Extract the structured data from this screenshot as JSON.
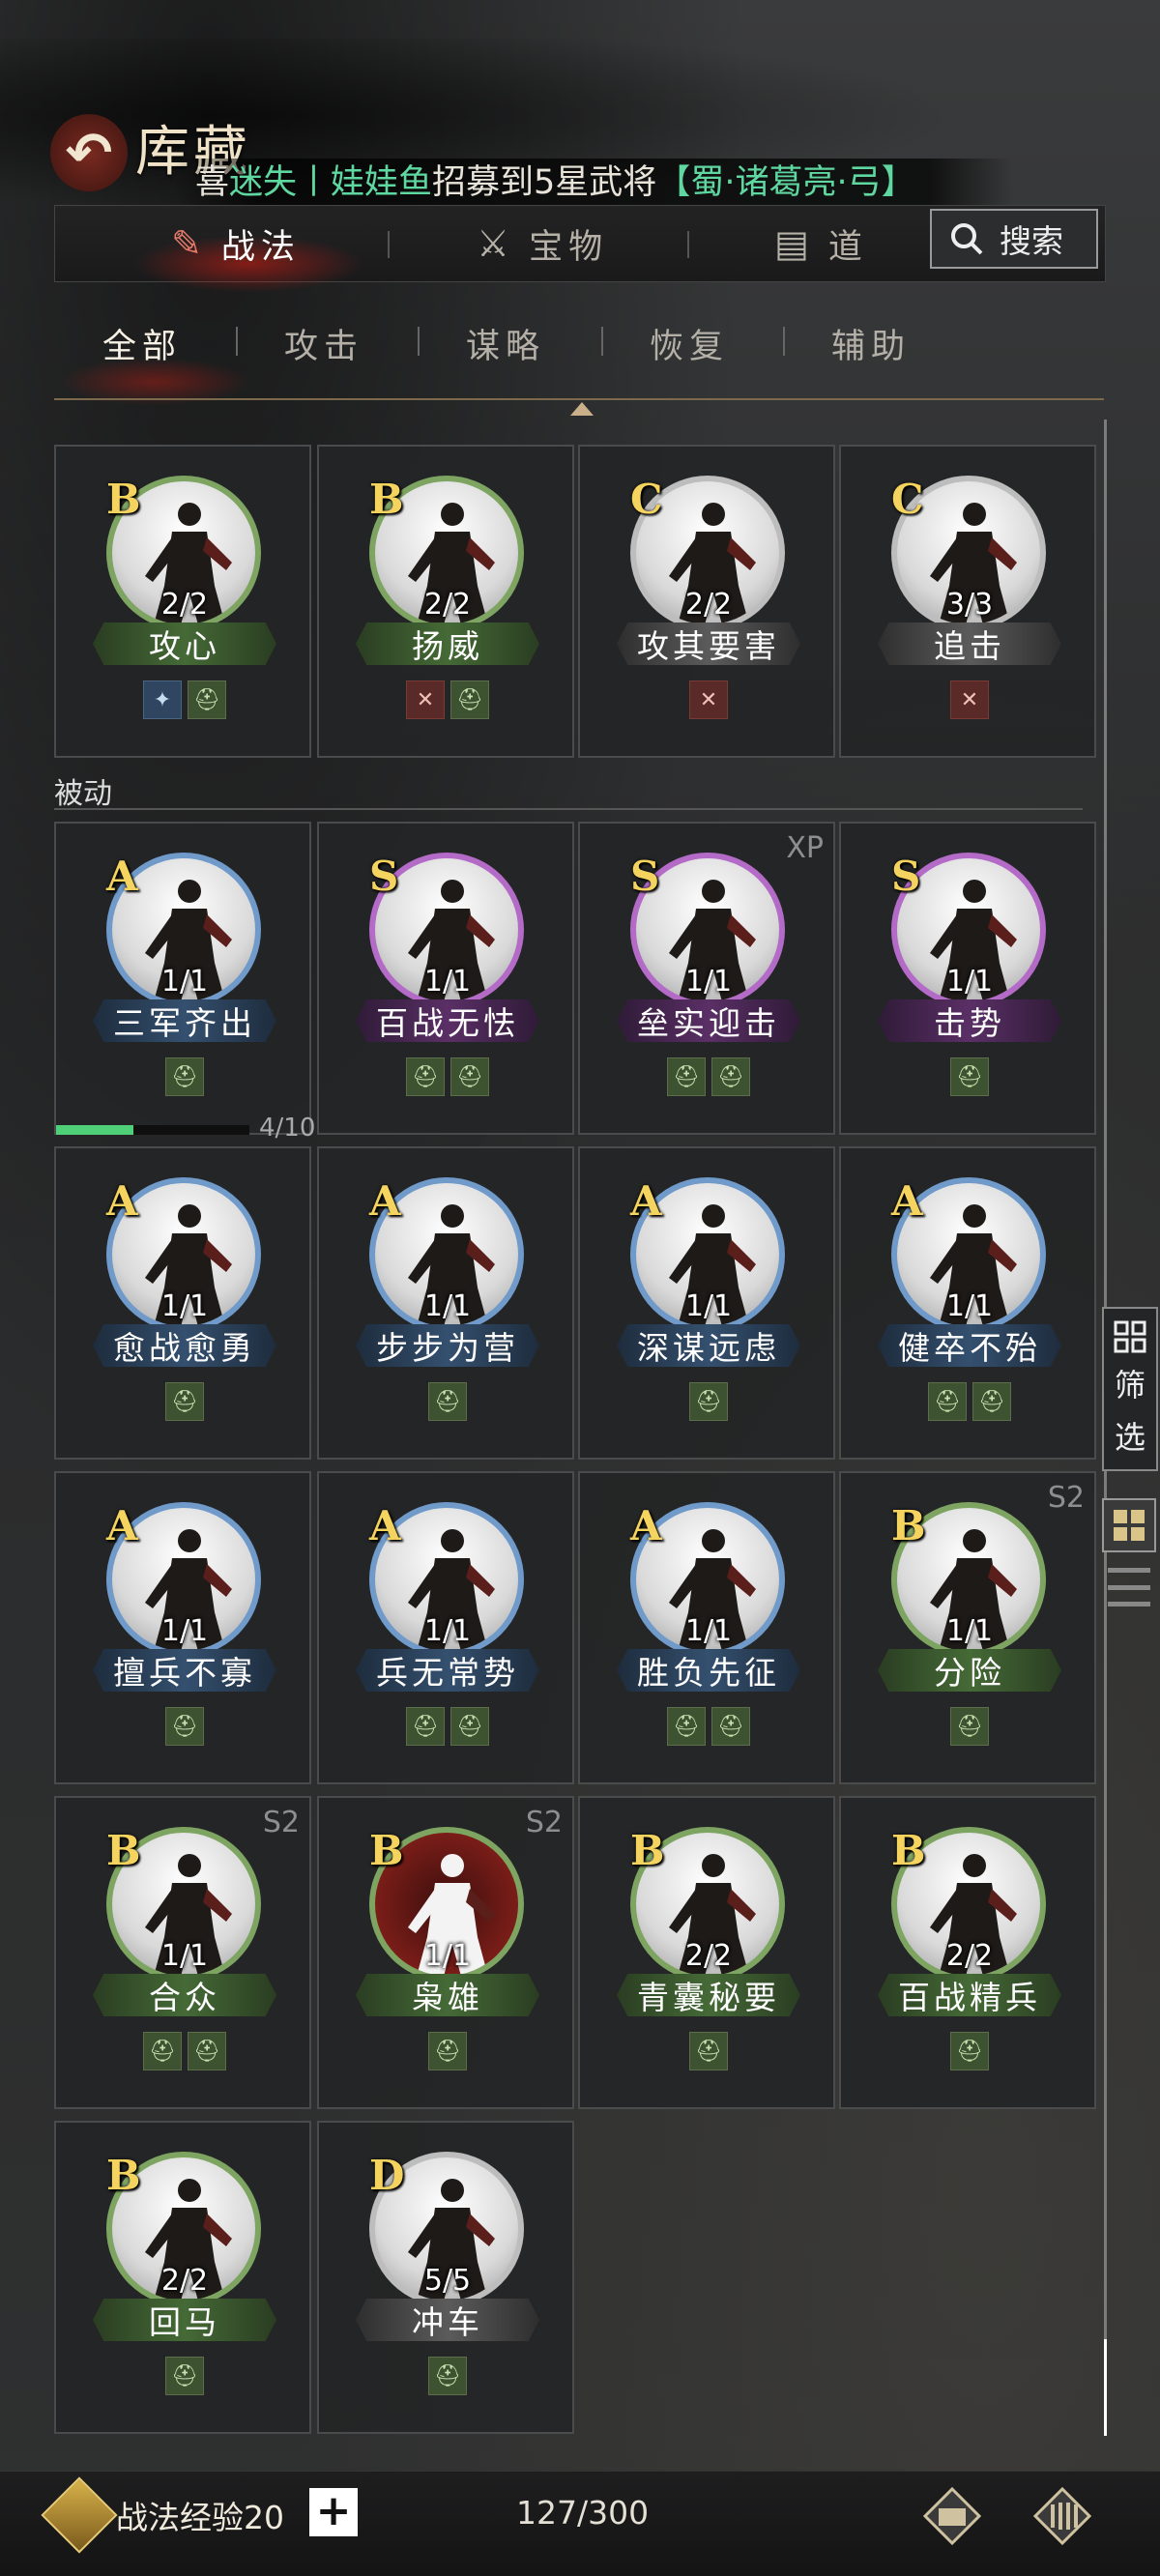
{
  "header": {
    "back_icon": "back-arrow-icon",
    "title": "库藏",
    "marquee": {
      "prefix": "喜",
      "name": "迷失丨娃娃鱼",
      "middle": "招募到5星武将",
      "hero": "【蜀·诸葛亮·弓】"
    }
  },
  "main_tabs": [
    {
      "label": "战法",
      "icon": "scroll-icon",
      "active": true
    },
    {
      "label": "宝物",
      "icon": "treasure-icon",
      "active": false
    },
    {
      "label": "道",
      "icon": "item-icon",
      "active": false
    }
  ],
  "search": {
    "label": "搜索",
    "icon": "search-icon"
  },
  "sub_tabs": [
    "全部",
    "攻击",
    "谋略",
    "恢复",
    "辅助"
  ],
  "active_sub_tab": "全部",
  "section_passive": "被动",
  "rows": [
    [
      {
        "grade": "B",
        "count": "2/2",
        "name": "攻心",
        "rarity": "B",
        "tags": [
          "b",
          "g"
        ]
      },
      {
        "grade": "B",
        "count": "2/2",
        "name": "扬威",
        "rarity": "B",
        "tags": [
          "r",
          "g"
        ]
      },
      {
        "grade": "C",
        "count": "2/2",
        "name": "攻其要害",
        "rarity": "C",
        "tags": [
          "r"
        ]
      },
      {
        "grade": "C",
        "count": "3/3",
        "name": "追击",
        "rarity": "C",
        "tags": [
          "r"
        ]
      }
    ],
    [
      {
        "grade": "A",
        "count": "1/1",
        "name": "三军齐出",
        "rarity": "A",
        "tags": [
          "g"
        ]
      },
      {
        "grade": "S",
        "count": "1/1",
        "name": "百战无怯",
        "rarity": "S",
        "tags": [
          "g",
          "g"
        ]
      },
      {
        "grade": "S",
        "count": "1/1",
        "name": "垒实迎击",
        "rarity": "S",
        "tags": [
          "g",
          "g"
        ],
        "corner": "XP"
      },
      {
        "grade": "S",
        "count": "1/1",
        "name": "击势",
        "rarity": "S",
        "tags": [
          "g"
        ]
      }
    ],
    [
      {
        "grade": "A",
        "count": "1/1",
        "name": "愈战愈勇",
        "rarity": "A",
        "tags": [
          "g"
        ]
      },
      {
        "grade": "A",
        "count": "1/1",
        "name": "步步为营",
        "rarity": "A",
        "tags": [
          "g"
        ]
      },
      {
        "grade": "A",
        "count": "1/1",
        "name": "深谋远虑",
        "rarity": "A",
        "tags": [
          "g"
        ]
      },
      {
        "grade": "A",
        "count": "1/1",
        "name": "健卒不殆",
        "rarity": "A",
        "tags": [
          "g",
          "g"
        ]
      }
    ],
    [
      {
        "grade": "A",
        "count": "1/1",
        "name": "擅兵不寡",
        "rarity": "A",
        "tags": [
          "g"
        ]
      },
      {
        "grade": "A",
        "count": "1/1",
        "name": "兵无常势",
        "rarity": "A",
        "tags": [
          "g",
          "g"
        ]
      },
      {
        "grade": "A",
        "count": "1/1",
        "name": "胜负先征",
        "rarity": "A",
        "tags": [
          "g",
          "g"
        ]
      },
      {
        "grade": "B",
        "count": "1/1",
        "name": "分险",
        "rarity": "B",
        "tags": [
          "g"
        ],
        "corner": "S2"
      }
    ],
    [
      {
        "grade": "B",
        "count": "1/1",
        "name": "合众",
        "rarity": "B",
        "tags": [
          "g",
          "g"
        ],
        "corner": "S2"
      },
      {
        "grade": "B",
        "count": "1/1",
        "name": "枭雄",
        "rarity": "B",
        "tags": [
          "g"
        ],
        "corner": "S2",
        "special": true
      },
      {
        "grade": "B",
        "count": "2/2",
        "name": "青囊秘要",
        "rarity": "B",
        "tags": [
          "g"
        ]
      },
      {
        "grade": "B",
        "count": "2/2",
        "name": "百战精兵",
        "rarity": "B",
        "tags": [
          "g"
        ]
      }
    ],
    [
      {
        "grade": "B",
        "count": "2/2",
        "name": "回马",
        "rarity": "B",
        "tags": [
          "g"
        ]
      },
      {
        "grade": "D",
        "count": "5/5",
        "name": "冲车",
        "rarity": "D",
        "tags": [
          "g"
        ]
      }
    ]
  ],
  "progress": {
    "text": "4/10",
    "value": 0.4
  },
  "side": {
    "filter_label_1": "筛",
    "filter_label_2": "选",
    "filter_icon": "filter-grid-icon",
    "grid_view_icon": "grid-view-icon",
    "list_view_icon": "list-view-icon"
  },
  "bottom": {
    "exp_label": "战法经验20",
    "plus": "+",
    "capacity": "127/300",
    "icon_a": "upgrade-scroll-icon",
    "icon_b": "bamboo-scroll-icon"
  },
  "colors": {
    "accent": "#5fd7a0",
    "grade_gold": "#f4d35e",
    "progress": "#4ecf78"
  }
}
